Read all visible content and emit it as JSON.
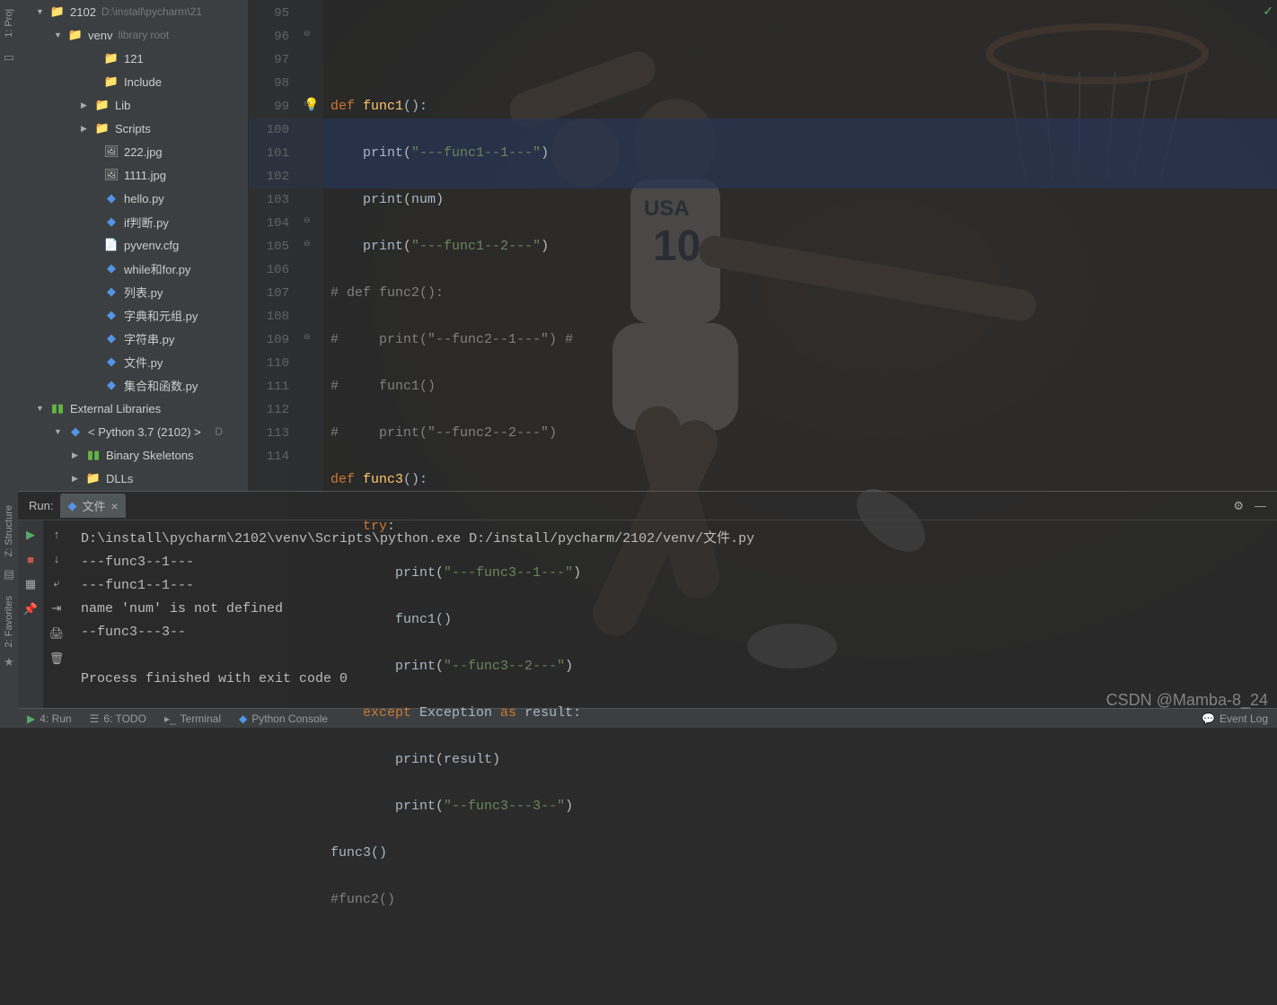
{
  "leftbar": {
    "tab1": "1: Proj",
    "tab2": "Z: Structure",
    "tab3": "2: Favorites"
  },
  "tree": {
    "root": {
      "label": "2102",
      "path": "D:\\install\\pycharm\\21"
    },
    "venv": {
      "label": "venv",
      "hint": "library root"
    },
    "d121": "121",
    "include": "Include",
    "lib": "Lib",
    "scripts": "Scripts",
    "f222": "222.jpg",
    "f1111": "1111.jpg",
    "hello": "hello.py",
    "ifpd": "if判断.py",
    "pyvenv": "pyvenv.cfg",
    "whilefor": "while和for.py",
    "liebiao": "列表.py",
    "zidian": "字典和元组.py",
    "zifuchuan": "字符串.py",
    "wenjian": "文件.py",
    "jihe": "集合和函数.py",
    "extlib": "External Libraries",
    "python": "< Python 3.7 (2102) >",
    "python_path": "D",
    "binskel": "Binary Skeletons",
    "dlls": "DLLs"
  },
  "code": {
    "lines": [
      "95",
      "96",
      "97",
      "98",
      "99",
      "100",
      "101",
      "102",
      "103",
      "104",
      "105",
      "106",
      "107",
      "108",
      "109",
      "110",
      "111",
      "112",
      "113",
      "114"
    ],
    "l96_def": "def ",
    "l96_fn": "func1",
    "l96_rest": "():",
    "l97_fn": "print",
    "l97_str": "\"---func1--1---\"",
    "l98_fn": "print",
    "l98_id": "num",
    "l99_fn": "print",
    "l99_str": "\"---func1--2---\"",
    "l100": "# def func2():",
    "l101": "#     print(\"--func2--1---\") #",
    "l102": "#     func1()",
    "l103": "#     print(\"--func2--2---\")",
    "l104_def": "def ",
    "l104_fn": "func3",
    "l104_rest": "():",
    "l105_try": "try",
    "l105_colon": ":",
    "l106_fn": "print",
    "l106_str": "\"---func3--1---\"",
    "l107": "func1()",
    "l108_fn": "print",
    "l108_str": "\"--func3--2---\"",
    "l109_except": "except ",
    "l109_exc": "Exception",
    "l109_as": " as ",
    "l109_res": "result",
    "l109_colon": ":",
    "l110_fn": "print",
    "l110_id": "result",
    "l111_fn": "print",
    "l111_str": "\"--func3---3--\"",
    "l112": "func3()",
    "l113": "#func2()"
  },
  "run": {
    "label": "Run:",
    "tab": "文件",
    "out1": "D:\\install\\pycharm\\2102\\venv\\Scripts\\python.exe D:/install/pycharm/2102/venv/文件.py",
    "out2": "---func3--1---",
    "out3": "---func1--1---",
    "out4": "name 'num' is not defined",
    "out5": "--func3---3--",
    "out6": "",
    "out7": "Process finished with exit code 0"
  },
  "bottom": {
    "run": "4: Run",
    "todo": "6: TODO",
    "terminal": "Terminal",
    "pyconsole": "Python Console",
    "eventlog": "Event Log"
  },
  "watermark": "CSDN @Mamba-8_24"
}
